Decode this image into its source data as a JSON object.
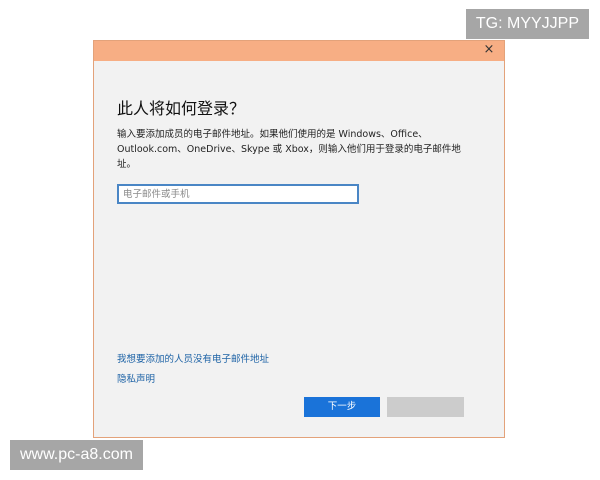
{
  "dialog": {
    "close_glyph": "×",
    "heading": "此人将如何登录？",
    "description": "输入要添加成员的电子邮件地址。如果他们使用的是 Windows、Office、Outlook.com、OneDrive、Skype 或 Xbox，则输入他们用于登录的电子邮件地址。",
    "email_input": {
      "value": "",
      "placeholder": "电子邮件或手机"
    },
    "link_no_email": "我想要添加的人员没有电子邮件地址",
    "link_privacy": "隐私声明",
    "next_button": "下一步",
    "colors": {
      "titlebar": "#f7ae84",
      "primary_button": "#1a73d9",
      "link": "#1e63a6"
    }
  },
  "watermarks": {
    "top_right": "TG: MYYJJPP",
    "bottom_left": "www.pc-a8.com"
  }
}
